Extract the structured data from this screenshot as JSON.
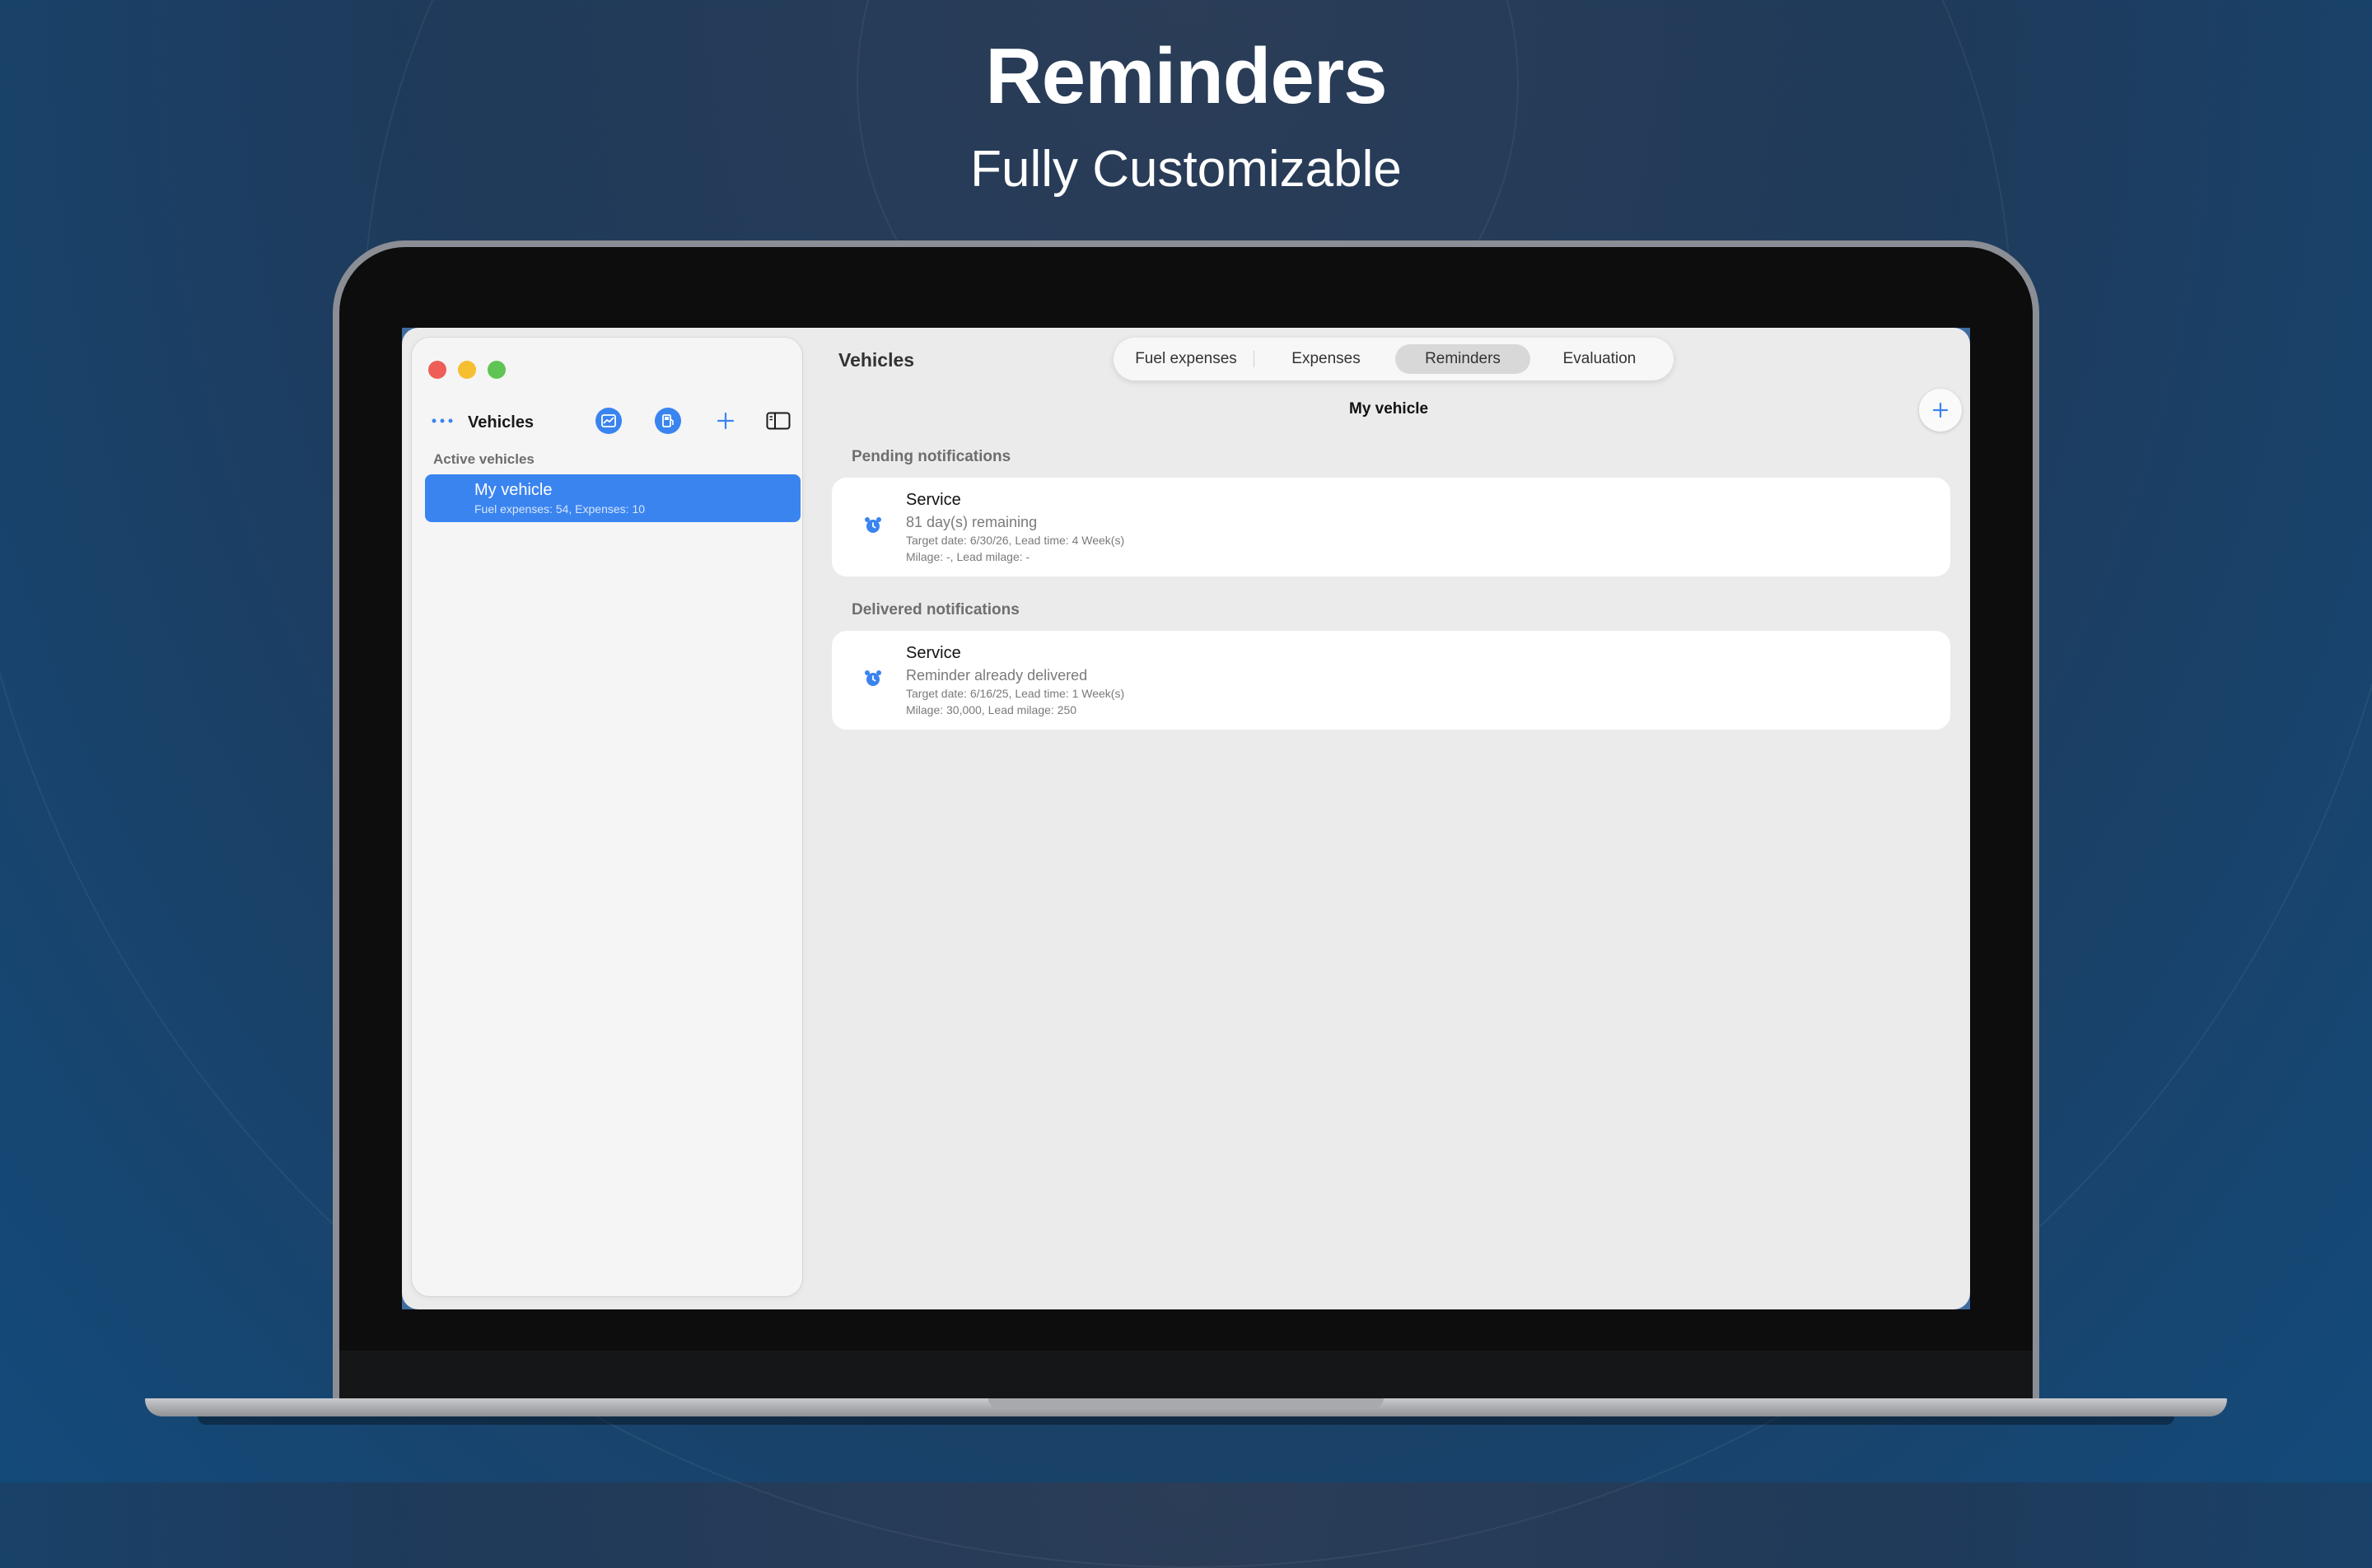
{
  "hero": {
    "title": "Reminders",
    "subtitle": "Fully Customizable"
  },
  "sidebar": {
    "title": "Vehicles",
    "toolbar_icons": [
      "more-icon",
      "chart-icon",
      "fuel-icon",
      "plus-icon",
      "sidebar-toggle-icon"
    ],
    "section_label": "Active vehicles",
    "vehicles": [
      {
        "name": "My vehicle",
        "summary": "Fuel expenses: 54, Expenses: 10",
        "selected": true
      }
    ]
  },
  "main": {
    "title": "Vehicles",
    "tabs": [
      {
        "label": "Fuel expenses",
        "active": false
      },
      {
        "label": "Expenses",
        "active": false
      },
      {
        "label": "Reminders",
        "active": true
      },
      {
        "label": "Evaluation",
        "active": false
      }
    ],
    "vehicle_title": "My vehicle",
    "groups": [
      {
        "label": "Pending notifications",
        "items": [
          {
            "title": "Service",
            "status": "81 day(s) remaining",
            "detail1": "Target date: 6/30/26, Lead time: 4 Week(s)",
            "detail2": "Milage: -, Lead milage: -",
            "icon": "alarm-clock-icon"
          }
        ]
      },
      {
        "label": "Delivered notifications",
        "items": [
          {
            "title": "Service",
            "status": "Reminder already delivered",
            "detail1": "Target date: 6/16/25, Lead time: 1 Week(s)",
            "detail2": "Milage: 30,000, Lead milage: 250",
            "icon": "alarm-clock-icon"
          }
        ]
      }
    ]
  },
  "colors": {
    "accent": "#3a84f0",
    "close": "#ee5e57",
    "minimize": "#f5bf2f",
    "zoom": "#5fc454"
  }
}
